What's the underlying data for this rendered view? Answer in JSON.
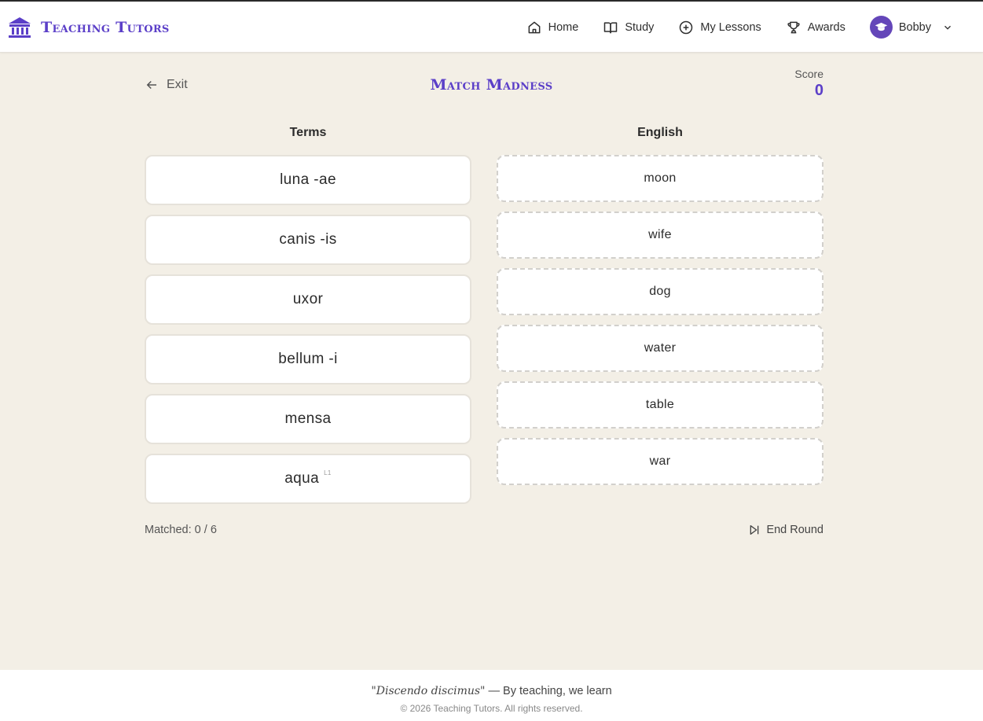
{
  "brand": {
    "name": "Teaching Tutors",
    "logo_icon": "institution-icon",
    "color": "#5b3fc8"
  },
  "nav": {
    "items": [
      {
        "label": "Home",
        "icon": "home-icon"
      },
      {
        "label": "Study",
        "icon": "book-open-icon"
      },
      {
        "label": "My Lessons",
        "icon": "plus-circle-icon"
      },
      {
        "label": "Awards",
        "icon": "trophy-icon"
      }
    ],
    "user": {
      "name": "Bobby",
      "avatar_icon": "graduation-cap-icon",
      "avatar_color": "#6446b9"
    }
  },
  "game": {
    "exit_label": "Exit",
    "title": "Match Madness",
    "score_label": "Score",
    "score_value": "0",
    "terms_header": "Terms",
    "english_header": "English",
    "terms": [
      {
        "text": "luna -ae",
        "tag": ""
      },
      {
        "text": "canis -is",
        "tag": ""
      },
      {
        "text": "uxor",
        "tag": ""
      },
      {
        "text": "bellum -i",
        "tag": ""
      },
      {
        "text": "mensa",
        "tag": ""
      },
      {
        "text": "aqua",
        "tag": "L1"
      }
    ],
    "english": [
      "moon",
      "wife",
      "dog",
      "water",
      "table",
      "war"
    ],
    "matched_text": "Matched: 0 / 6",
    "end_round_label": "End Round"
  },
  "footer": {
    "quote": "\"Discendo discimus\"",
    "quote_translation": "— By teaching, we learn",
    "copyright": "© 2026 Teaching Tutors. All rights reserved."
  }
}
